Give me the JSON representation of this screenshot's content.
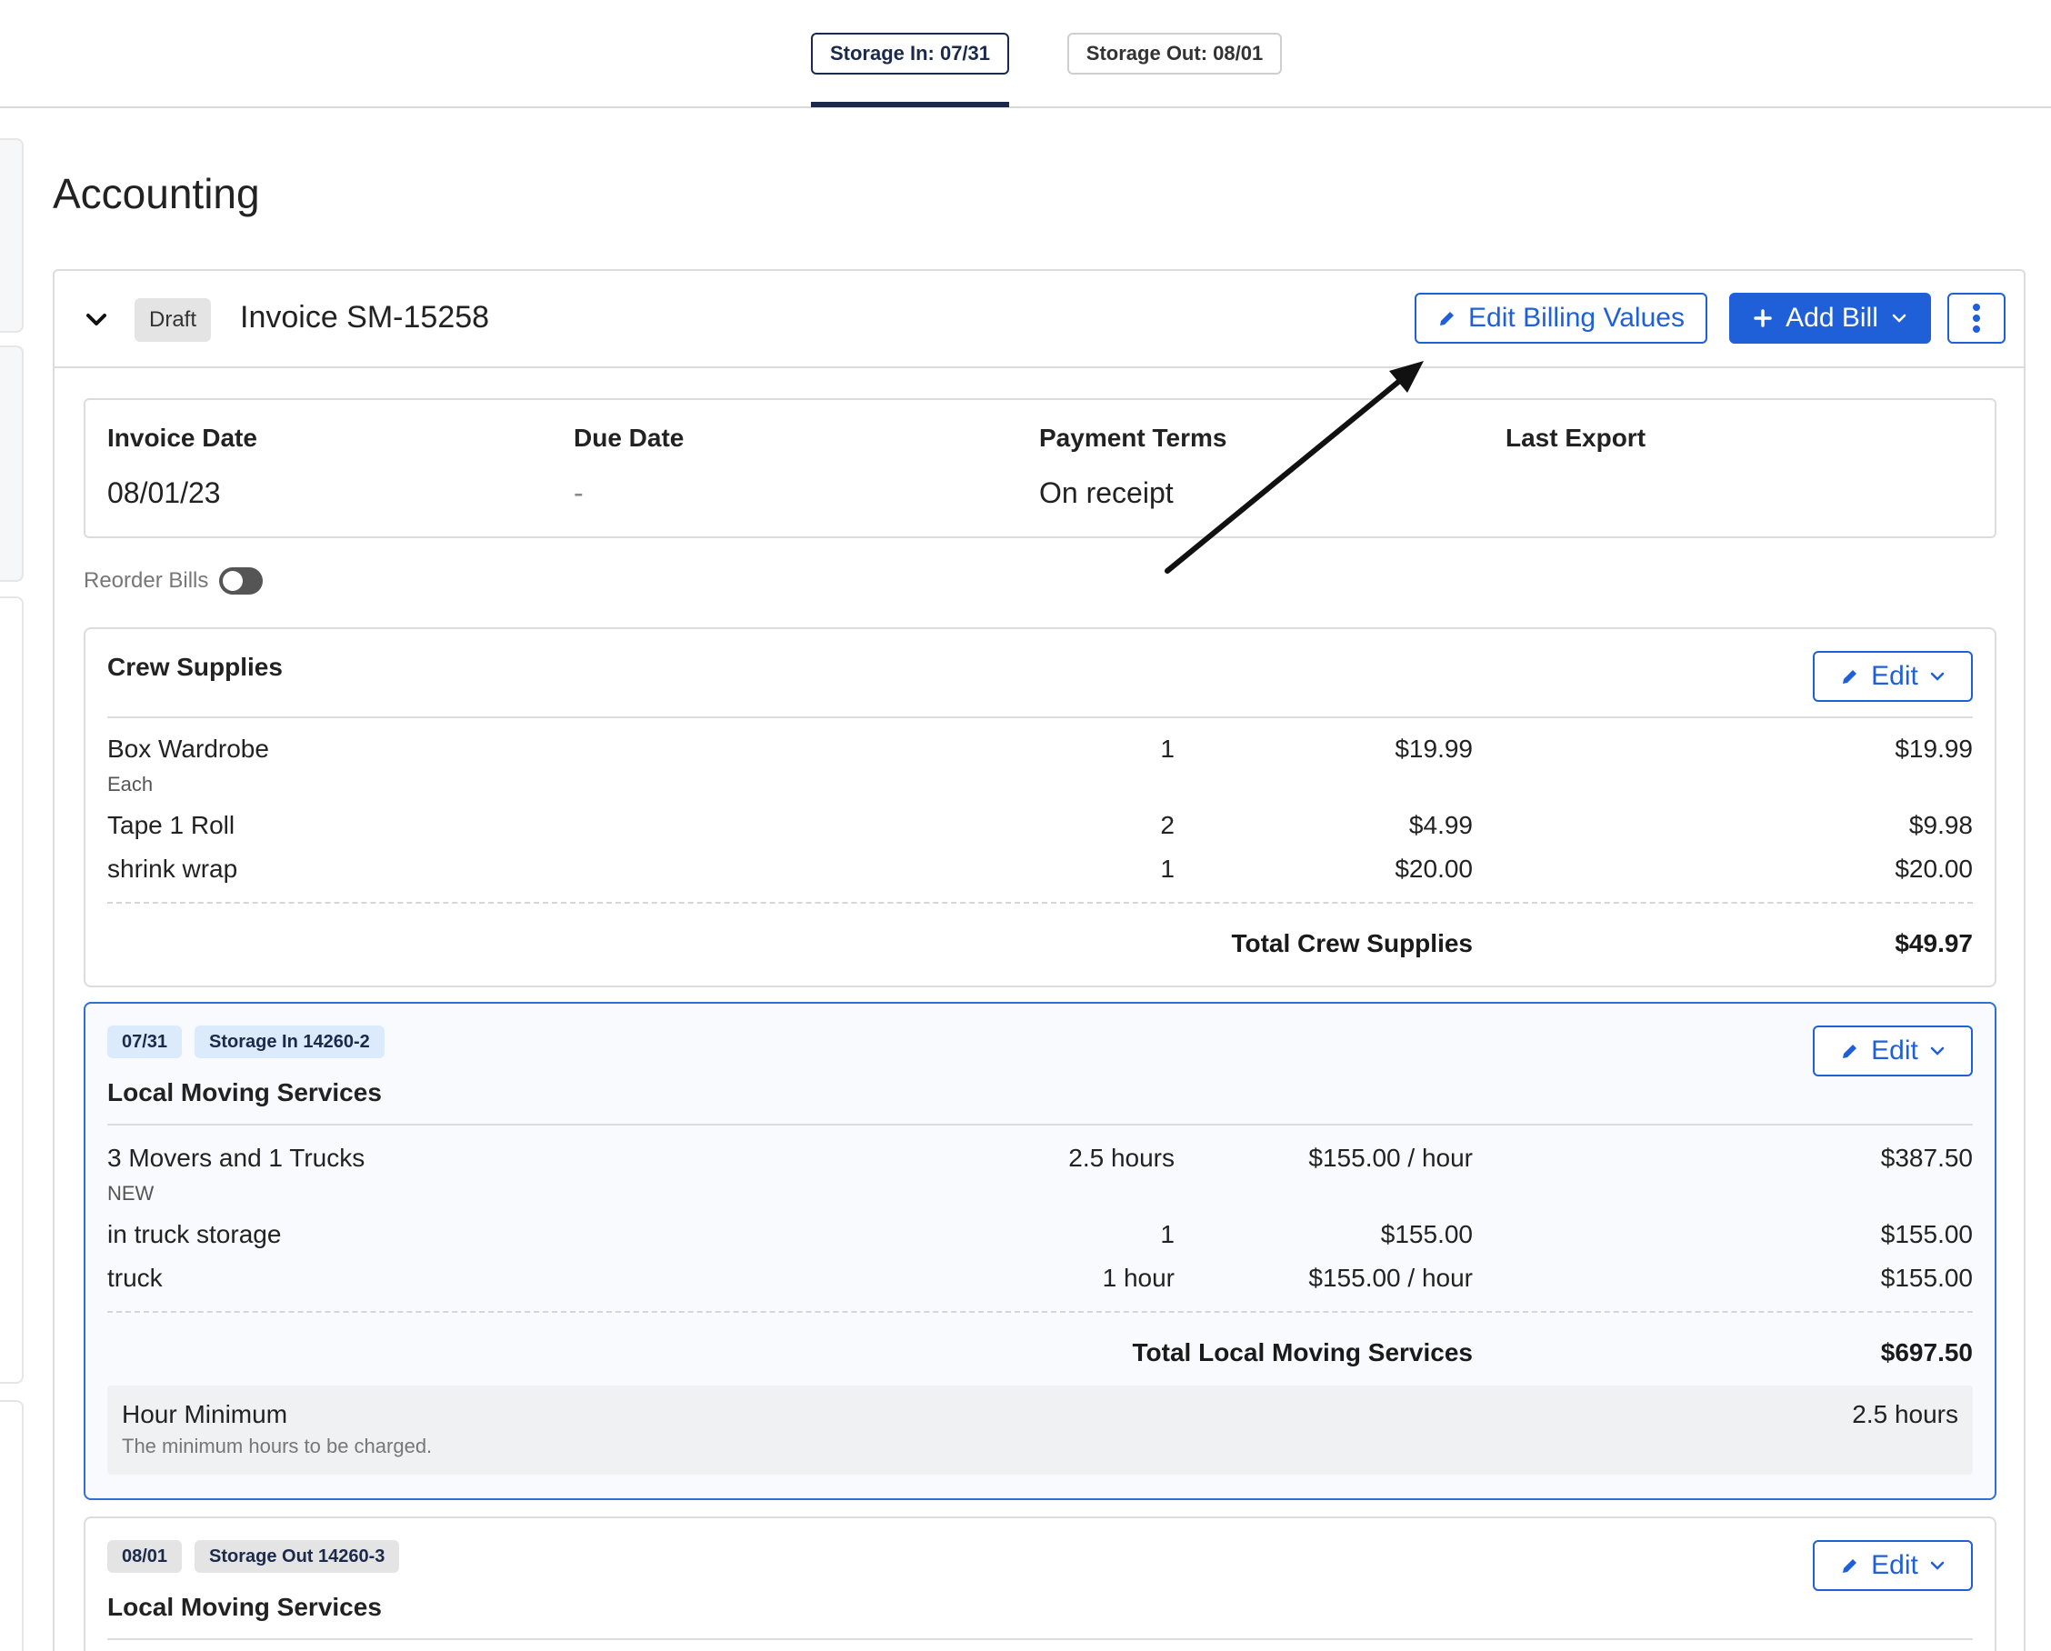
{
  "top_tabs": [
    {
      "label": "Storage In: 07/31",
      "active": true
    },
    {
      "label": "Storage Out: 08/01",
      "active": false
    }
  ],
  "page": {
    "title": "Accounting"
  },
  "invoice": {
    "status": "Draft",
    "title": "Invoice SM-15258",
    "edit_billing_label": "Edit Billing Values",
    "add_bill_label": "Add Bill",
    "info": [
      {
        "label": "Invoice Date",
        "value": "08/01/23"
      },
      {
        "label": "Due Date",
        "value": "-"
      },
      {
        "label": "Payment Terms",
        "value": "On receipt"
      },
      {
        "label": "Last Export",
        "value": ""
      }
    ],
    "reorder_label": "Reorder Bills"
  },
  "bills": {
    "crew": {
      "title": "Crew Supplies",
      "edit_label": "Edit",
      "rows": [
        {
          "name": "Box Wardrobe",
          "qty": "1",
          "rate": "$19.99",
          "total": "$19.99",
          "sub": "Each"
        },
        {
          "name": "Tape 1 Roll",
          "qty": "2",
          "rate": "$4.99",
          "total": "$9.98"
        },
        {
          "name": "shrink wrap",
          "qty": "1",
          "rate": "$20.00",
          "total": "$20.00"
        }
      ],
      "total_label": "Total Crew Supplies",
      "total_value": "$49.97"
    },
    "local1": {
      "date_tag": "07/31",
      "job_tag": "Storage In 14260-2",
      "title": "Local Moving Services",
      "edit_label": "Edit",
      "rows": [
        {
          "name": "3 Movers and 1 Trucks",
          "qty": "2.5 hours",
          "rate": "$155.00 / hour",
          "total": "$387.50",
          "sub": "NEW"
        },
        {
          "name": "in truck storage",
          "qty": "1",
          "rate": "$155.00",
          "total": "$155.00"
        },
        {
          "name": "truck",
          "qty": "1 hour",
          "rate": "$155.00 / hour",
          "total": "$155.00"
        }
      ],
      "total_label": "Total Local Moving Services",
      "total_value": "$697.50",
      "minimum": {
        "title": "Hour Minimum",
        "desc": "The minimum hours to be charged.",
        "value": "2.5 hours"
      }
    },
    "local2": {
      "date_tag": "08/01",
      "job_tag": "Storage Out 14260-3",
      "title": "Local Moving Services",
      "edit_label": "Edit"
    }
  },
  "colors": {
    "accent": "#1f5fd8",
    "navy": "#1b2a4a",
    "highlight_border": "#2f6fd6"
  }
}
